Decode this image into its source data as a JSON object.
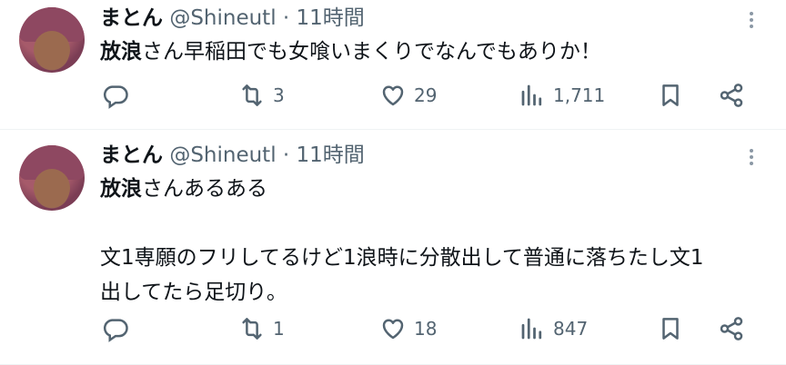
{
  "tweets": [
    {
      "author": "まとん",
      "handle": "@Shineutl",
      "separator": "·",
      "time": "11時間",
      "mention": "放浪",
      "text": "さん早稲田でも女喰いまくりでなんでもありか！",
      "replies": "",
      "retweets": "3",
      "likes": "29",
      "views": "1,711"
    },
    {
      "author": "まとん",
      "handle": "@Shineutl",
      "separator": "·",
      "time": "11時間",
      "mention": "放浪",
      "text": "さんあるある\n\n文1専願のフリしてるけど1浪時に分散出して普通に落ちたし文1\n出してたら足切り。",
      "replies": "",
      "retweets": "1",
      "likes": "18",
      "views": "847"
    }
  ],
  "icons": {
    "reply": "reply-icon",
    "retweet": "retweet-icon",
    "like": "heart-icon",
    "views": "views-icon",
    "bookmark": "bookmark-icon",
    "share": "share-icon",
    "more": "more-options-icon"
  },
  "colors": {
    "text": "#0f1419",
    "secondary": "#536471",
    "divider": "#eff3f4"
  }
}
